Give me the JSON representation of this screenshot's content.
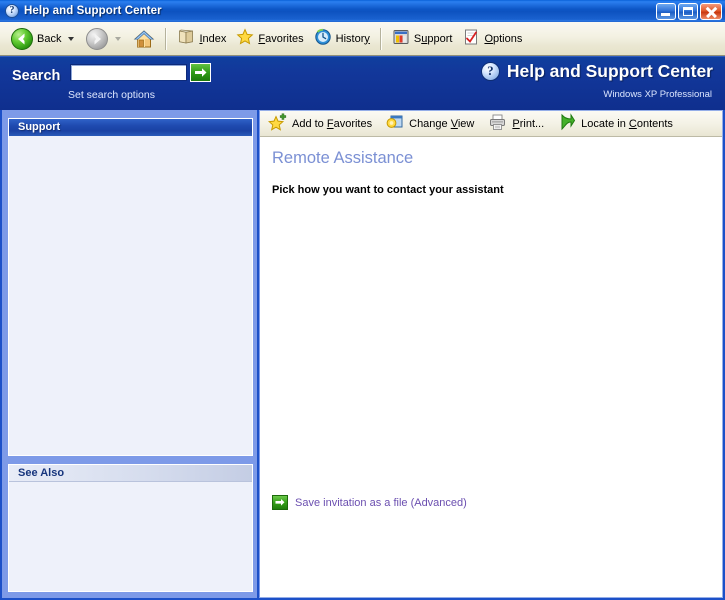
{
  "window": {
    "title": "Help and Support Center",
    "title_icon": "question-mark-circle-icon",
    "minimize_label": "Minimize",
    "maximize_label": "Maximize",
    "close_label": "Close"
  },
  "toolbar": {
    "back_label": "Back",
    "back_icon": "back-arrow-icon",
    "forward_icon": "forward-arrow-icon",
    "home_icon": "home-house-icon",
    "items": [
      {
        "label": "Index",
        "accel": "I",
        "icon": "index-book-icon"
      },
      {
        "label": "Favorites",
        "accel": "F",
        "icon": "favorites-star-icon"
      },
      {
        "label": "History",
        "accel": "y",
        "icon": "history-clock-icon"
      },
      {
        "label": "Support",
        "accel": "u",
        "icon": "support-window-icon"
      },
      {
        "label": "Options",
        "accel": "O",
        "icon": "options-checkmark-icon"
      }
    ]
  },
  "search": {
    "label": "Search",
    "value": "",
    "placeholder": "",
    "go_label": "Go",
    "go_icon": "green-arrow-go-icon",
    "options_link": "Set search options"
  },
  "brand": {
    "icon": "question-mark-circle-icon",
    "title": "Help and Support Center",
    "subtitle": "Windows XP Professional"
  },
  "sidebar": {
    "panels": [
      {
        "title": "Support",
        "style": "blue",
        "items": []
      },
      {
        "title": "See Also",
        "style": "light",
        "items": []
      }
    ]
  },
  "content_toolbar": {
    "items": [
      {
        "label": "Add to Favorites",
        "accel": "F",
        "icon": "add-to-favorites-star-icon"
      },
      {
        "label": "Change View",
        "accel": "V",
        "icon": "change-view-window-icon"
      },
      {
        "label": "Print...",
        "accel": "P",
        "icon": "printer-icon"
      },
      {
        "label": "Locate in Contents",
        "accel": "C",
        "icon": "locate-in-contents-arrow-icon"
      }
    ]
  },
  "main": {
    "page_title": "Remote Assistance",
    "subtitle": "Pick how you want to contact your assistant",
    "save_link": "Save invitation as a file (Advanced)",
    "save_link_icon": "green-arrow-go-icon"
  },
  "colors": {
    "title_bar_blue": "#0d56c6",
    "brand_bar_blue": "#12379a",
    "frame_blue": "#1c50c8",
    "panel_bg": "#eef1fa",
    "page_title_color": "#7b90d4",
    "link_color": "#6b4fb0",
    "accent_green": "#2f9c17"
  }
}
